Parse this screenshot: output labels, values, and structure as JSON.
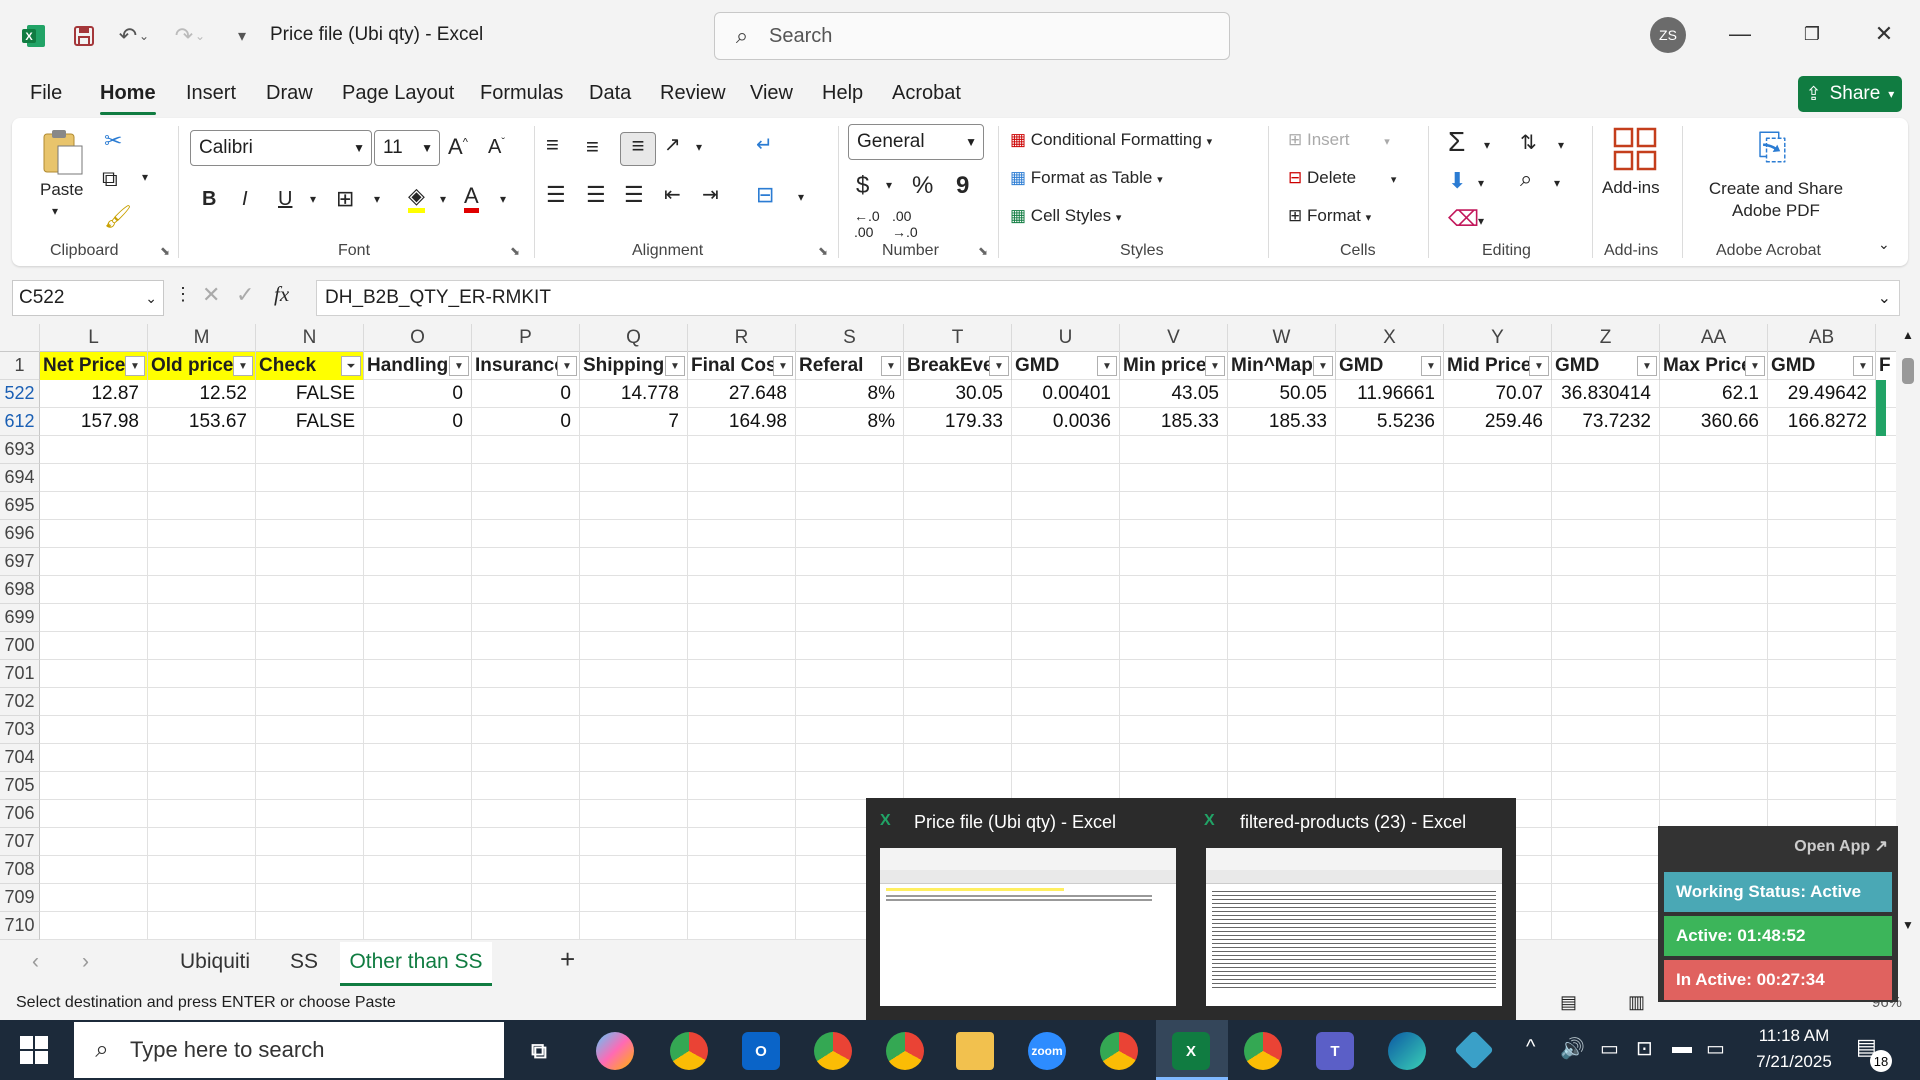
{
  "titlebar": {
    "doc_title": "Price file (Ubi qty)  -  Excel",
    "search_placeholder": "Search",
    "avatar_initials": "ZS"
  },
  "menu": {
    "tabs": [
      "File",
      "Home",
      "Insert",
      "Draw",
      "Page Layout",
      "Formulas",
      "Data",
      "Review",
      "View",
      "Help",
      "Acrobat"
    ],
    "active": "Home",
    "share_label": "Share"
  },
  "ribbon": {
    "clipboard": {
      "paste_label": "Paste",
      "group": "Clipboard"
    },
    "font": {
      "name": "Calibri",
      "size": "11",
      "group": "Font",
      "bold": "B",
      "italic": "I",
      "underline": "U"
    },
    "alignment": {
      "group": "Alignment"
    },
    "number": {
      "format": "General",
      "group": "Number",
      "currency": "$",
      "percent": "%",
      "comma": "9"
    },
    "styles": {
      "conditional": "Conditional Formatting",
      "table": "Format as Table",
      "cell": "Cell Styles",
      "group": "Styles"
    },
    "cells": {
      "insert": "Insert",
      "delete": "Delete",
      "format": "Format",
      "group": "Cells"
    },
    "editing": {
      "group": "Editing"
    },
    "addins": {
      "label": "Add-ins",
      "group": "Add-ins"
    },
    "acrobat": {
      "label": "Create and Share Adobe PDF",
      "group": "Adobe Acrobat"
    },
    "accent_color": "#107c41"
  },
  "formula_bar": {
    "name_box": "C522",
    "fx_label": "fx",
    "formula": "DH_B2B_QTY_ER-RMKIT"
  },
  "grid": {
    "columns": [
      "L",
      "M",
      "N",
      "O",
      "P",
      "Q",
      "R",
      "S",
      "T",
      "U",
      "V",
      "W",
      "X",
      "Y",
      "Z",
      "AA",
      "AB"
    ],
    "header_row_number": "1",
    "headers": [
      "Net Price",
      "Old price",
      "Check",
      "Handling",
      "Insurance",
      "Shipping",
      "Final Cost",
      "Referal",
      "BreakEve",
      "GMD",
      "Min price",
      "Min^Map",
      "GMD",
      "Mid Price",
      "GMD",
      "Max Price",
      "GMD"
    ],
    "overflow_header": "F",
    "rows": [
      {
        "num": "522",
        "cells": [
          "12.87",
          "12.52",
          "FALSE",
          "0",
          "0",
          "14.778",
          "27.648",
          "8%",
          "30.05",
          "0.00401",
          "43.05",
          "50.05",
          "11.96661",
          "70.07",
          "36.830414",
          "62.1",
          "29.49642"
        ]
      },
      {
        "num": "612",
        "cells": [
          "157.98",
          "153.67",
          "FALSE",
          "0",
          "0",
          "7",
          "164.98",
          "8%",
          "179.33",
          "0.0036",
          "185.33",
          "185.33",
          "5.5236",
          "259.46",
          "73.7232",
          "360.66",
          "166.8272"
        ]
      }
    ],
    "empty_rows": [
      "693",
      "694",
      "695",
      "696",
      "697",
      "698",
      "699",
      "700",
      "701",
      "702",
      "703",
      "704",
      "705",
      "706",
      "707",
      "708",
      "709",
      "710"
    ]
  },
  "sheets": {
    "tabs": [
      "Ubiquiti",
      "SS",
      "Other than SS"
    ],
    "active": "Other than SS",
    "add": "+"
  },
  "status": {
    "message": "Select destination and press ENTER or choose Paste",
    "zoom": "96%"
  },
  "thumbnails": [
    {
      "title": "Price file (Ubi qty) - Excel"
    },
    {
      "title": "filtered-products (23) - Excel"
    }
  ],
  "widget": {
    "open_app": "Open App ↗",
    "working": "Working Status: Active",
    "active": "Active: 01:48:52",
    "inactive": "In Active: 00:27:34"
  },
  "taskbar": {
    "search_placeholder": "Type here to search",
    "time": "11:18 AM",
    "date": "7/21/2025",
    "notification_count": "18",
    "zoom_app": "zoom"
  }
}
